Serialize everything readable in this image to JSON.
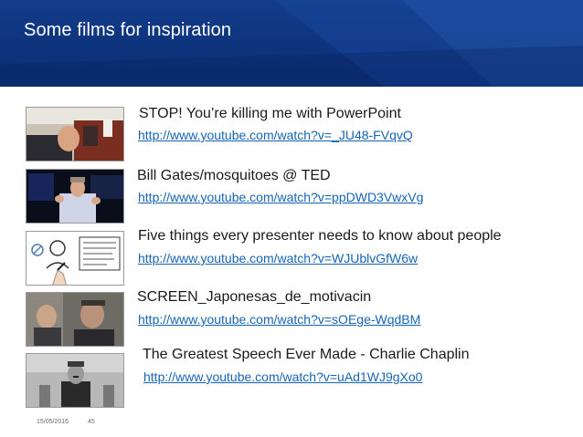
{
  "slide": {
    "title": "Some films for inspiration",
    "films": [
      {
        "title": "STOP! You’re killing me with PowerPoint",
        "url": "http://www.youtube.com/watch?v=_JU48-FVqvQ",
        "thumbnail": "man-sleeping-at-desk-photo"
      },
      {
        "title": "Bill Gates/mosquitoes @ TED",
        "url": "http://www.youtube.com/watch?v=ppDWD3VwxVg",
        "thumbnail": "speaker-on-stage-photo"
      },
      {
        "title": "Five things every presenter needs to know about people",
        "url": "http://www.youtube.com/watch?v=WJUblvGfW6w",
        "thumbnail": "whiteboard-sketch-drawing"
      },
      {
        "title": "SCREEN_Japonesas_de_motivacin",
        "url": "http://www.youtube.com/watch?v=sOEge-WqdBM",
        "thumbnail": "movie-scene-two-men-photo"
      },
      {
        "title": "The Greatest Speech Ever Made - Charlie Chaplin",
        "url": "http://www.youtube.com/watch?v=uAd1WJ9gXo0",
        "thumbnail": "black-and-white-film-still"
      }
    ],
    "footer": {
      "date": "15/05/2016",
      "page": "45"
    }
  },
  "colors": {
    "header": "#0f357f",
    "link": "#1565b4",
    "text": "#1a1a1a"
  }
}
